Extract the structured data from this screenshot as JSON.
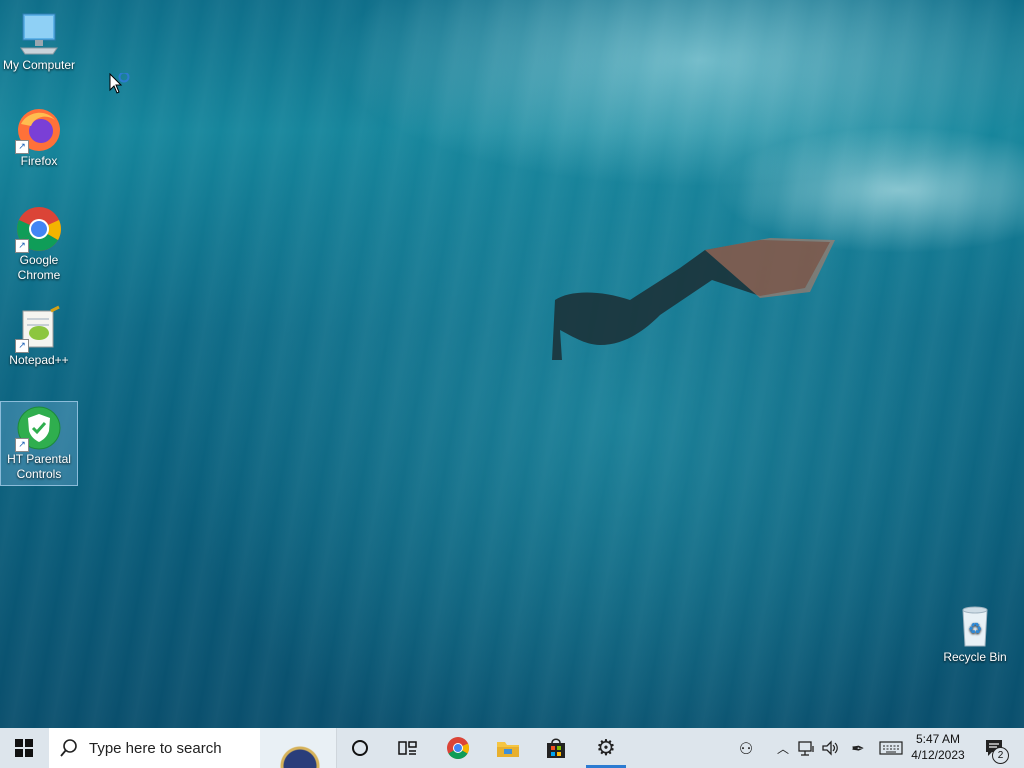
{
  "desktop": {
    "icons": [
      {
        "label": "My Computer"
      },
      {
        "label": "Firefox"
      },
      {
        "label": "Google Chrome"
      },
      {
        "label": "Notepad++"
      },
      {
        "label": "HT Parental Controls"
      },
      {
        "label": "Recycle Bin"
      }
    ]
  },
  "taskbar": {
    "search_placeholder": "Type here to search",
    "pinned": [
      "cortana-icon",
      "task-view-icon",
      "chrome-icon",
      "file-explorer-icon",
      "microsoft-store-icon",
      "settings-icon"
    ],
    "active_app": "settings-icon"
  },
  "tray": {
    "time": "5:47 AM",
    "date": "4/12/2023",
    "notification_count": "2"
  },
  "colors": {
    "taskbar": "#dde5ec",
    "accent": "#2c7bd1",
    "selection": "#78b4dc"
  }
}
